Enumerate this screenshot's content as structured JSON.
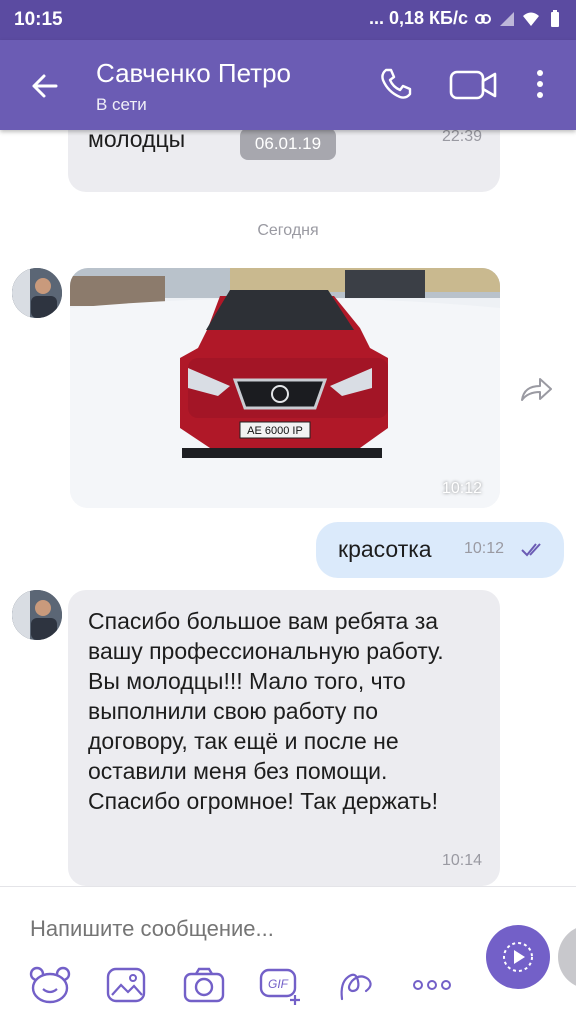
{
  "status_bar": {
    "time": "10:15",
    "network_speed": "... 0,18 КБ/с"
  },
  "header": {
    "contact_name": "Савченко Петро",
    "status": "В сети"
  },
  "messages": {
    "m1": {
      "text": "молодцы",
      "time": "22:39"
    },
    "date_pill": "06.01.19",
    "day_separator": "Сегодня",
    "photo": {
      "time": "10:12"
    },
    "outgoing": {
      "text": "красотка",
      "time": "10:12"
    },
    "m3": {
      "text": "Спасибо большое вам ребята за вашу профессиональную работу. Вы молодцы!!!  Мало того, что выполнили свою работу по договору, так ещё и после не оставили меня без помощи. Спасибо огромное!  Так держать!",
      "time": "10:14"
    }
  },
  "composer": {
    "placeholder": "Напишите сообщение..."
  },
  "license_plate": "AE 6000 IP",
  "colors": {
    "status_bar": "#5b4ba1",
    "app_bar": "#6b5cb4",
    "incoming_bubble": "#ececf0",
    "outgoing_bubble": "#dbeafb",
    "send_button": "#7360c8"
  }
}
